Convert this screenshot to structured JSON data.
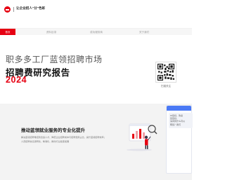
{
  "header": {
    "tagline": "让企业招人\"分\"色彩"
  },
  "nav": {
    "items": [
      {
        "label": "首页",
        "active": true
      },
      {
        "label": "资料目录",
        "active": false
      },
      {
        "label": "成功服务商",
        "active": false
      },
      {
        "label": "关于我们",
        "active": false
      }
    ]
  },
  "hero": {
    "title": "职多多工厂蓝领招聘市场",
    "subtitle": "招聘费研究报告",
    "year": "2024",
    "qr_caption": "扫描关注"
  },
  "mission": {
    "title": "推动蓝领就业服务的专业化提升",
    "lines": [
      "解决蓝领招聘难招到合适人才、降低企业招聘成本与招聘费用占比，提升蓝领招聘效率；",
      "人员招聘信息透明化、精准化，推动行业健康发展"
    ]
  },
  "chat": {
    "lines": [
      "HI您好，欢迎",
      "您您好，",
      "请问有什么可以",
      "帮您？我们"
    ]
  },
  "colors": {
    "brand_red": "#e60012",
    "chat_blue": "#4a79f5"
  }
}
